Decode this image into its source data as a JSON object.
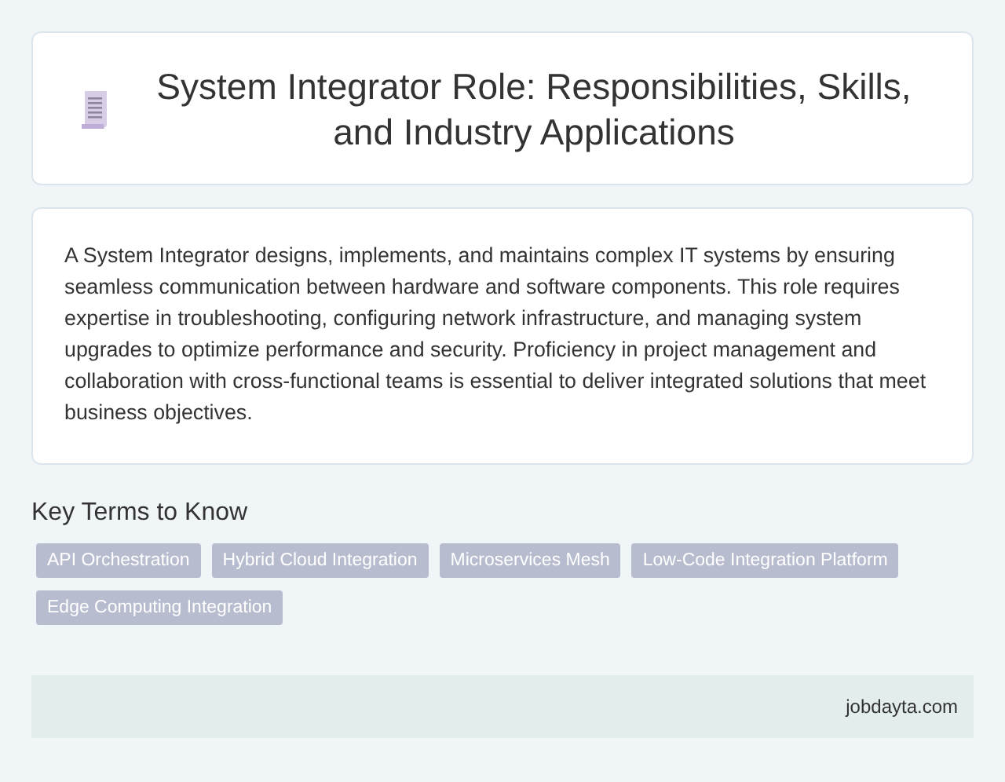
{
  "header": {
    "title": "System Integrator Role: Responsibilities, Skills, and Industry Applications"
  },
  "summary": {
    "text": "A System Integrator designs, implements, and maintains complex IT systems by ensuring seamless communication between hardware and software components. This role requires expertise in troubleshooting, configuring network infrastructure, and managing system upgrades to optimize performance and security. Proficiency in project management and collaboration with cross-functional teams is essential to deliver integrated solutions that meet business objectives."
  },
  "key_terms": {
    "heading": "Key Terms to Know",
    "tags": [
      "API Orchestration",
      "Hybrid Cloud Integration",
      "Microservices Mesh",
      "Low-Code Integration Platform",
      "Edge Computing Integration"
    ]
  },
  "footer": {
    "site": "jobdayta.com"
  }
}
